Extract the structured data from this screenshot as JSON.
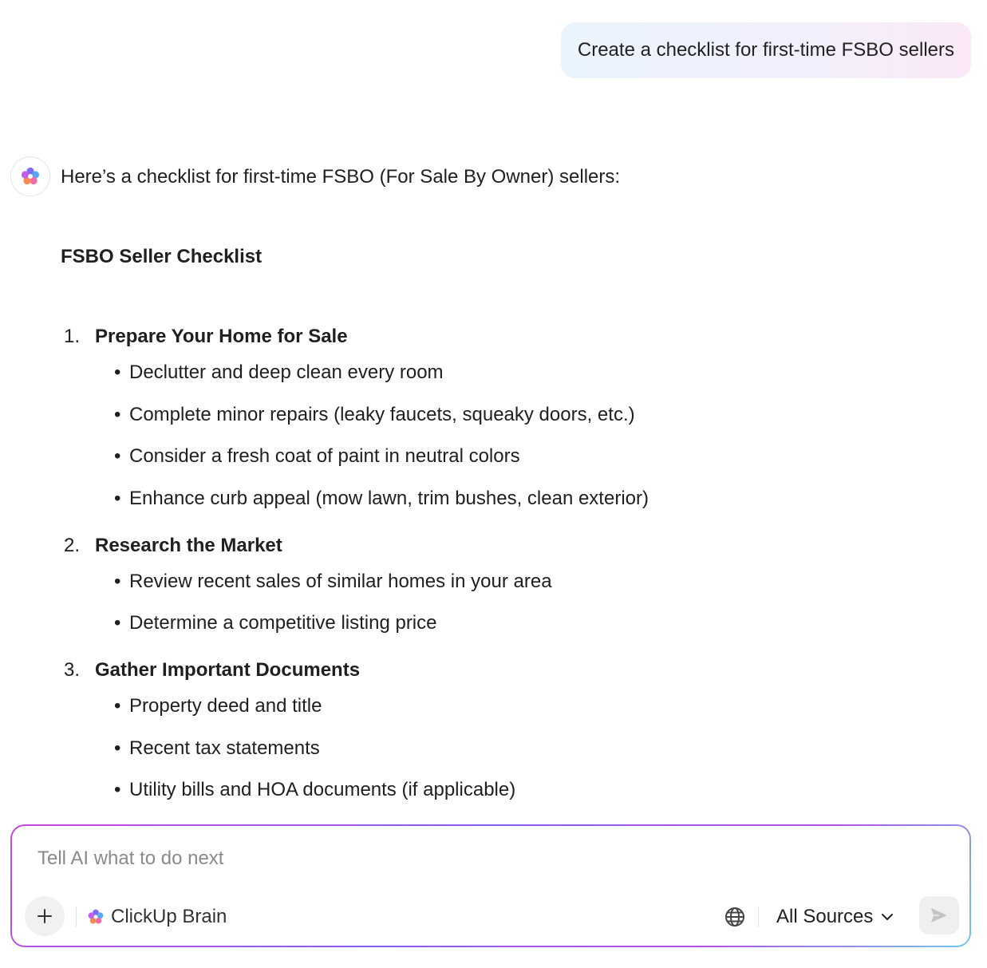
{
  "user_message": "Create a checklist for first-time FSBO sellers",
  "assistant": {
    "intro": "Here’s a checklist for first-time FSBO (For Sale By Owner) sellers:",
    "title": "FSBO Seller Checklist",
    "sections": [
      {
        "number": "1.",
        "heading": "Prepare Your Home for Sale",
        "items": [
          "Declutter and deep clean every room",
          "Complete minor repairs (leaky faucets, squeaky doors, etc.)",
          "Consider a fresh coat of paint in neutral colors",
          "Enhance curb appeal (mow lawn, trim bushes, clean exterior)"
        ]
      },
      {
        "number": "2.",
        "heading": "Research the Market",
        "items": [
          "Review recent sales of similar homes in your area",
          "Determine a competitive listing price"
        ]
      },
      {
        "number": "3.",
        "heading": "Gather Important Documents",
        "items": [
          "Property deed and title",
          "Recent tax statements",
          "Utility bills and HOA documents (if applicable)"
        ]
      }
    ]
  },
  "composer": {
    "placeholder": "Tell AI what to do next",
    "value": "",
    "brain_label": "ClickUp Brain",
    "sources_label": "All Sources"
  },
  "icons": {
    "avatar": "clickup-brain-icon",
    "add": "plus-icon",
    "web": "globe-icon",
    "sources_toggle": "chevron-down-icon",
    "send": "send-icon"
  }
}
